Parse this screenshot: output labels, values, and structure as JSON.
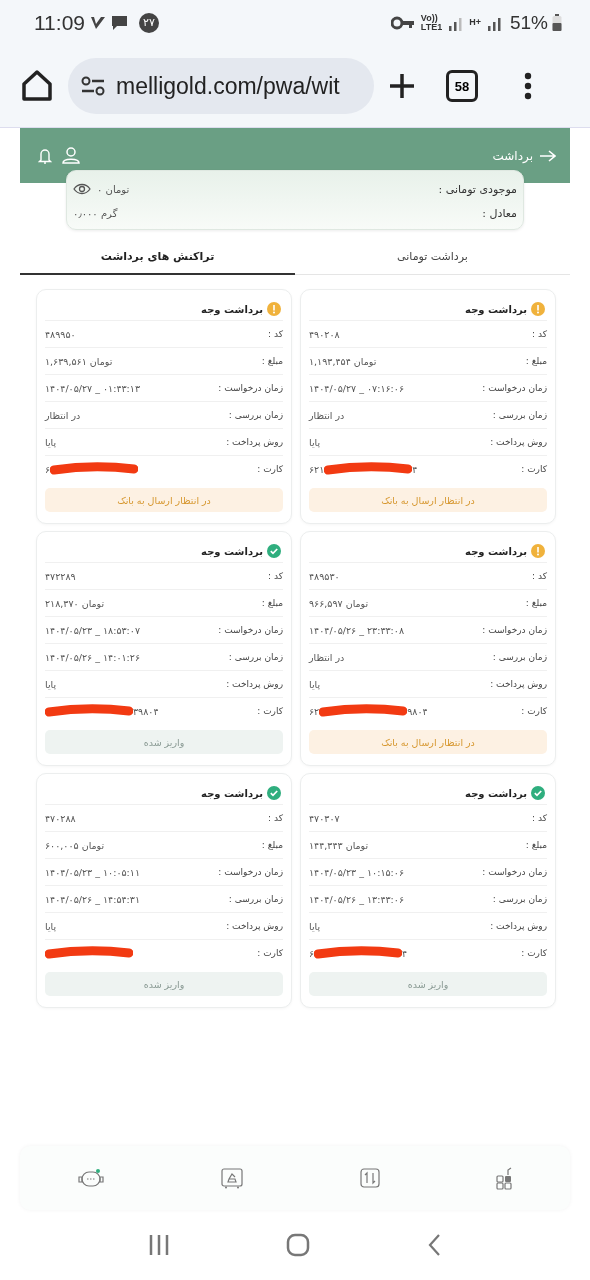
{
  "status_bar": {
    "time": "11:09",
    "notification_count": "۲۷",
    "network_labels": [
      "Vo))",
      "LTE1",
      "H+"
    ],
    "battery": "51%"
  },
  "browser": {
    "url": "melligold.com/pwa/wit",
    "tab_count": "58"
  },
  "header": {
    "title": "برداشت"
  },
  "balance": {
    "rows": [
      {
        "label": "موجودی تومانی :",
        "value": "۰ تومان",
        "kind": "toggle"
      },
      {
        "label": "معادل :",
        "value": "۰٫۰۰۰ گرم",
        "kind": "plain"
      }
    ]
  },
  "tabs": [
    {
      "label": "برداشت تومانی",
      "selected": false
    },
    {
      "label": "تراکنش های برداشت",
      "selected": true
    }
  ],
  "cards": [
    {
      "title": "برداشت وجه",
      "kind": "pending",
      "fields": [
        {
          "label": "کد :",
          "value": "۴۹۰۲۰۸"
        },
        {
          "label": "مبلغ :",
          "value": "۱,۱۹۳,۴۵۴ تومان"
        },
        {
          "label": "زمان درخواست :",
          "value": "۱۴۰۴/۰۵/۲۷ _ ۰۷:۱۶:۰۶"
        },
        {
          "label": "زمان بررسی :",
          "value": "در انتظار"
        },
        {
          "label": "روش پرداخت :",
          "value": "پایا"
        }
      ],
      "card": {
        "label": "کارت :",
        "shown_start": "۶۲۱",
        "shown_end": "۴",
        "redacted": true
      },
      "state_label": "در انتظار ارسال به بانک"
    },
    {
      "title": "برداشت وجه",
      "kind": "pending",
      "fields": [
        {
          "label": "کد :",
          "value": "۴۸۹۹۵۰"
        },
        {
          "label": "مبلغ :",
          "value": "۱,۶۳۹,۵۶۱ تومان"
        },
        {
          "label": "زمان درخواست :",
          "value": "۱۴۰۴/۰۵/۲۷ _ ۰۱:۴۳:۱۳"
        },
        {
          "label": "زمان بررسی :",
          "value": "در انتظار"
        },
        {
          "label": "روش پرداخت :",
          "value": "پایا"
        }
      ],
      "card": {
        "label": "کارت :",
        "shown_start": "۶",
        "redacted": true
      },
      "state_label": "در انتظار ارسال به بانک"
    },
    {
      "title": "برداشت وجه",
      "kind": "pending",
      "fields": [
        {
          "label": "کد :",
          "value": "۴۸۹۵۳۰"
        },
        {
          "label": "مبلغ :",
          "value": "۹۶۶,۵۹۷ تومان"
        },
        {
          "label": "زمان درخواست :",
          "value": "۱۴۰۴/۰۵/۲۶ _ ۲۳:۳۳:۰۸"
        },
        {
          "label": "زمان بررسی :",
          "value": "در انتظار"
        },
        {
          "label": "روش پرداخت :",
          "value": "پایا"
        }
      ],
      "card": {
        "label": "کارت :",
        "shown_start": "۶۲",
        "shown_end": "۹۸۰۴",
        "redacted": true
      },
      "state_label": "در انتظار ارسال به بانک"
    },
    {
      "title": "برداشت وجه",
      "kind": "done",
      "fields": [
        {
          "label": "کد :",
          "value": "۴۷۲۲۸۹"
        },
        {
          "label": "مبلغ :",
          "value": "۲۱۸,۳۷۰ تومان"
        },
        {
          "label": "زمان درخواست :",
          "value": "۱۴۰۴/۰۵/۲۳ _ ۱۸:۵۳:۰۷"
        },
        {
          "label": "زمان بررسی :",
          "value": "۱۴۰۴/۰۵/۲۶ _ ۱۴:۰۱:۲۶"
        },
        {
          "label": "روش پرداخت :",
          "value": "پایا"
        }
      ],
      "card": {
        "label": "کارت :",
        "shown_end": "۳۹۸۰۴",
        "redacted": true
      },
      "state_label": "واریز شده"
    },
    {
      "title": "برداشت وجه",
      "kind": "done",
      "fields": [
        {
          "label": "کد :",
          "value": "۴۷۰۳۰۷"
        },
        {
          "label": "مبلغ :",
          "value": "۱۴۴,۳۴۳ تومان"
        },
        {
          "label": "زمان درخواست :",
          "value": "۱۴۰۴/۰۵/۲۳ _ ۱۰:۱۵:۰۶"
        },
        {
          "label": "زمان بررسی :",
          "value": "۱۴۰۴/۰۵/۲۶ _ ۱۳:۴۳:۰۶"
        },
        {
          "label": "روش پرداخت :",
          "value": "پایا"
        }
      ],
      "card": {
        "label": "کارت :",
        "shown_start": "۶",
        "shown_end": "۴",
        "redacted": true
      },
      "state_label": "واریز شده"
    },
    {
      "title": "برداشت وجه",
      "kind": "done",
      "fields": [
        {
          "label": "کد :",
          "value": "۴۷۰۲۸۸"
        },
        {
          "label": "مبلغ :",
          "value": "۶۰۰,۰۰۵ تومان"
        },
        {
          "label": "زمان درخواست :",
          "value": "۱۴۰۴/۰۵/۲۳ _ ۱۰:۰۵:۱۱"
        },
        {
          "label": "زمان بررسی :",
          "value": "۱۴۰۴/۰۵/۲۶ _ ۱۴:۵۴:۳۱"
        },
        {
          "label": "روش پرداخت :",
          "value": "پایا"
        }
      ],
      "card": {
        "label": "کارت :",
        "redacted": true
      },
      "state_label": "واریز شده"
    }
  ],
  "bottom_nav": [
    {
      "kind": "support"
    },
    {
      "kind": "gold"
    },
    {
      "kind": "transfer"
    },
    {
      "kind": "apps"
    }
  ]
}
